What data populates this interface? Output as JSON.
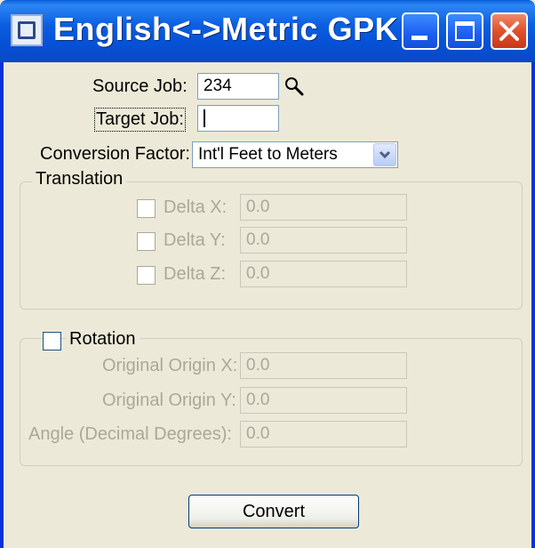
{
  "window": {
    "title": "English<->Metric GPK ...",
    "title_bar_color": "#0a5fd8",
    "icons": [
      "app-icon",
      "minimize-icon",
      "maximize-icon",
      "close-icon"
    ]
  },
  "form": {
    "source_job": {
      "label": "Source Job:",
      "value": "234",
      "icon": "search-icon"
    },
    "target_job": {
      "label": "Target Job:",
      "value": ""
    },
    "conversion_factor": {
      "label": "Conversion Factor:",
      "selected": "Int'l Feet to Meters"
    }
  },
  "translation": {
    "legend": "Translation",
    "fields": [
      {
        "label": "Delta X:",
        "value": "0.0"
      },
      {
        "label": "Delta Y:",
        "value": "0.0"
      },
      {
        "label": "Delta Z:",
        "value": "0.0"
      }
    ]
  },
  "rotation": {
    "legend": "Rotation",
    "fields": [
      {
        "label": "Original Origin X:",
        "value": "0.0"
      },
      {
        "label": "Original Origin Y:",
        "value": "0.0"
      },
      {
        "label": "Angle (Decimal Degrees):",
        "value": "0.0"
      }
    ]
  },
  "actions": {
    "convert_label": "Convert"
  }
}
